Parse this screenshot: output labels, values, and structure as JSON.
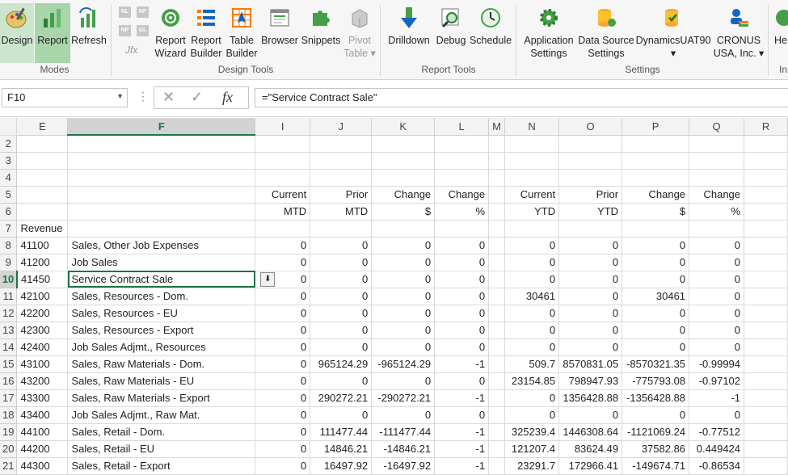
{
  "ribbon": {
    "modes": {
      "design": "Design",
      "report": "Report",
      "refresh": "Refresh",
      "group": "Modes"
    },
    "design_tools": {
      "small_icons": [
        "NL",
        "NF",
        "NP",
        "GL"
      ],
      "fx_label": "Jfx",
      "report_wizard": [
        "Report",
        "Wizard"
      ],
      "report_builder": [
        "Report",
        "Builder"
      ],
      "table_builder": [
        "Table",
        "Builder"
      ],
      "browser": "Browser",
      "snippets": "Snippets",
      "pivot_table": [
        "Pivot",
        "Table ▾"
      ],
      "group": "Design Tools"
    },
    "report_tools": {
      "drilldown": "Drilldown",
      "debug": "Debug",
      "schedule": "Schedule",
      "group": "Report Tools"
    },
    "settings": {
      "application_settings": [
        "Application",
        "Settings"
      ],
      "data_source_settings": [
        "Data Source",
        "Settings"
      ],
      "dynamics": [
        "DynamicsUAT90",
        "▾"
      ],
      "company": [
        "CRONUS",
        "USA, Inc. ▾"
      ],
      "group": "Settings"
    },
    "help": {
      "label": "He",
      "group": "In"
    }
  },
  "formula_bar": {
    "name_box": "F10",
    "formula": "=\"Service Contract Sale\""
  },
  "grid": {
    "columns": [
      "E",
      "F",
      "I",
      "J",
      "K",
      "L",
      "M",
      "N",
      "O",
      "P",
      "Q",
      "R"
    ],
    "selected_column": "F",
    "selected_row": "10",
    "rows": [
      {
        "n": "2",
        "cells": [
          "",
          "",
          "",
          "",
          "",
          "",
          "",
          "",
          "",
          "",
          "",
          ""
        ]
      },
      {
        "n": "3",
        "cells": [
          "",
          "",
          "",
          "",
          "",
          "",
          "",
          "",
          "",
          "",
          "",
          ""
        ]
      },
      {
        "n": "4",
        "cells": [
          "",
          "",
          "",
          "",
          "",
          "",
          "",
          "",
          "",
          "",
          "",
          ""
        ]
      },
      {
        "n": "5",
        "cells": [
          "",
          "",
          "Current",
          "Prior",
          "Change",
          "Change",
          "",
          "Current",
          "Prior",
          "Change",
          "Change",
          ""
        ]
      },
      {
        "n": "6",
        "cells": [
          "",
          "",
          "MTD",
          "MTD",
          "$",
          "%",
          "",
          "YTD",
          "YTD",
          "$",
          "%",
          ""
        ]
      },
      {
        "n": "7",
        "cells": [
          "Revenue",
          "",
          "",
          "",
          "",
          "",
          "",
          "",
          "",
          "",
          "",
          ""
        ]
      },
      {
        "n": "8",
        "cells": [
          "41100",
          "Sales, Other Job Expenses",
          "0",
          "0",
          "0",
          "0",
          "",
          "0",
          "0",
          "0",
          "0",
          ""
        ]
      },
      {
        "n": "9",
        "cells": [
          "41200",
          "Job Sales",
          "0",
          "0",
          "0",
          "0",
          "",
          "0",
          "0",
          "0",
          "0",
          ""
        ]
      },
      {
        "n": "10",
        "cells": [
          "41450",
          "Service Contract Sale",
          "0",
          "0",
          "0",
          "0",
          "",
          "0",
          "0",
          "0",
          "0",
          ""
        ]
      },
      {
        "n": "11",
        "cells": [
          "42100",
          "Sales, Resources - Dom.",
          "0",
          "0",
          "0",
          "0",
          "",
          "30461",
          "0",
          "30461",
          "0",
          ""
        ]
      },
      {
        "n": "12",
        "cells": [
          "42200",
          "Sales, Resources - EU",
          "0",
          "0",
          "0",
          "0",
          "",
          "0",
          "0",
          "0",
          "0",
          ""
        ]
      },
      {
        "n": "13",
        "cells": [
          "42300",
          "Sales, Resources - Export",
          "0",
          "0",
          "0",
          "0",
          "",
          "0",
          "0",
          "0",
          "0",
          ""
        ]
      },
      {
        "n": "14",
        "cells": [
          "42400",
          "Job Sales Adjmt., Resources",
          "0",
          "0",
          "0",
          "0",
          "",
          "0",
          "0",
          "0",
          "0",
          ""
        ]
      },
      {
        "n": "15",
        "cells": [
          "43100",
          "Sales, Raw Materials - Dom.",
          "0",
          "965124.29",
          "-965124.29",
          "-1",
          "",
          "509.7",
          "8570831.05",
          "-8570321.35",
          "-0.99994",
          ""
        ]
      },
      {
        "n": "16",
        "cells": [
          "43200",
          "Sales, Raw Materials - EU",
          "0",
          "0",
          "0",
          "0",
          "",
          "23154.85",
          "798947.93",
          "-775793.08",
          "-0.97102",
          ""
        ]
      },
      {
        "n": "17",
        "cells": [
          "43300",
          "Sales, Raw Materials - Export",
          "0",
          "290272.21",
          "-290272.21",
          "-1",
          "",
          "0",
          "1356428.88",
          "-1356428.88",
          "-1",
          ""
        ]
      },
      {
        "n": "18",
        "cells": [
          "43400",
          "Job Sales Adjmt., Raw Mat.",
          "0",
          "0",
          "0",
          "0",
          "",
          "0",
          "0",
          "0",
          "0",
          ""
        ]
      },
      {
        "n": "19",
        "cells": [
          "44100",
          "Sales, Retail - Dom.",
          "0",
          "111477.44",
          "-111477.44",
          "-1",
          "",
          "325239.4",
          "1446308.64",
          "-1121069.24",
          "-0.77512",
          ""
        ]
      },
      {
        "n": "20",
        "cells": [
          "44200",
          "Sales, Retail - EU",
          "0",
          "14846.21",
          "-14846.21",
          "-1",
          "",
          "121207.4",
          "83624.49",
          "37582.86",
          "0.449424",
          ""
        ]
      },
      {
        "n": "21",
        "cells": [
          "44300",
          "Sales, Retail - Export",
          "0",
          "16497.92",
          "-16497.92",
          "-1",
          "",
          "23291.7",
          "172966.41",
          "-149674.71",
          "-0.86534",
          ""
        ]
      }
    ]
  },
  "colors": {
    "accent": "#217346",
    "active_mode": "#cbe6cc"
  }
}
